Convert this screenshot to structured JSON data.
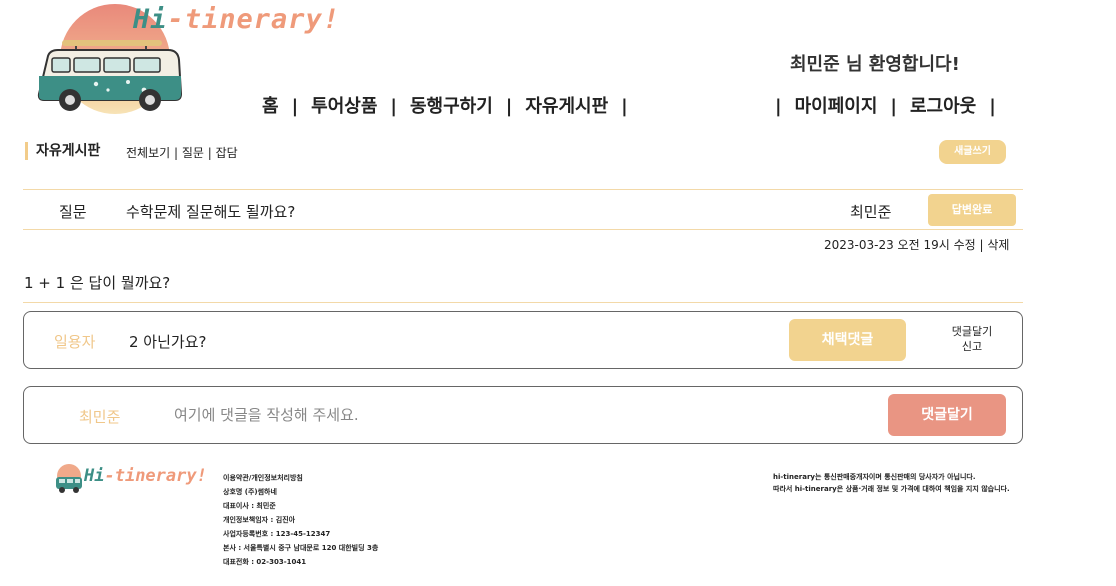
{
  "header": {
    "logo_text_hi": "Hi",
    "logo_text_rest": "-tinerary!",
    "welcome": "최민준 님 환영합니다!",
    "nav_left": [
      "홈",
      "투어상품",
      "동행구하기",
      "자유게시판"
    ],
    "nav_right": [
      "마이페이지",
      "로그아웃"
    ]
  },
  "board": {
    "title": "자유게시판",
    "filter": "전체보기 | 질문 | 잡담",
    "write_button": "새글쓰기"
  },
  "post": {
    "category": "질문",
    "title": "수학문제 질문해도 될까요?",
    "author": "최민준",
    "status_button": "답변완료",
    "meta": "2023-03-23 오전 19시 수정 | 삭제",
    "body": "1 + 1 은 답이 뭘까요?"
  },
  "comment": {
    "author": "일용자",
    "text": "2 아닌가요?",
    "select_button": "채택댓글",
    "action_reply": "댓글달기",
    "action_report": "신고"
  },
  "reply": {
    "author": "최민준",
    "placeholder": "여기에 댓글을 작성해 주세요.",
    "submit_button": "댓글달기"
  },
  "footer": {
    "logo_text_hi": "Hi",
    "logo_text_rest": "-tinerary!",
    "info": [
      "이용약관/개인정보처리방침",
      "상호명 (주)썸하네",
      "대표이사 : 최민준",
      "개인정보책임자 : 김진아",
      "사업자등록번호 : 123-45-12347",
      "본사 : 서울특별시 중구 남대문로 120 대한빌딩 3층",
      "대표전화 : 02-303-1041"
    ],
    "notice": [
      "hi-tinerary는 통신판매중개자이며 통신판매의 당사자가 아닙니다.",
      "따라서 hi-tinerary은 상품·거래 정보 및 가격에 대하여 책임을 지지 않습니다."
    ]
  },
  "colors": {
    "accent_yellow": "#f2d38f",
    "accent_coral": "#e99583",
    "teal": "#3d8f86"
  }
}
